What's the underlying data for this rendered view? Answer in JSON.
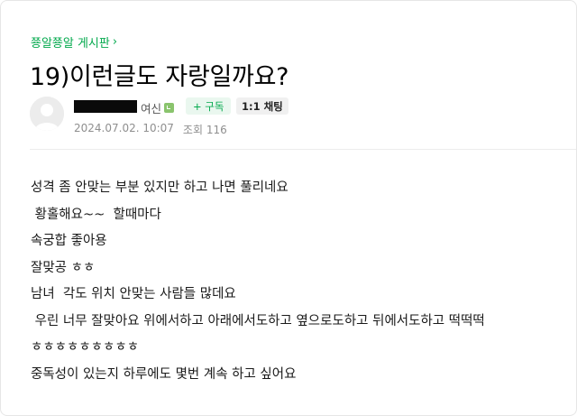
{
  "post": {
    "board_name": "쭁알쭁알 게시판",
    "board_chevron": "›",
    "title": "19)이런글도 자랑일까요?",
    "author": {
      "grade_label": "여신"
    },
    "subscribe_label": "+ 구독",
    "chat_label": "1:1 채팅",
    "date": "2024.07.02. 10:07",
    "views_label": "조회 116",
    "body_lines": [
      "성격 좀 안맞는 부분 있지만 하고 나면 풀리네요",
      " 황홀해요~~  할때마다",
      "속궁합 좋아용",
      "잘맞공 ㅎㅎ",
      "남녀  각도 위치 안맞는 사람들 많데요",
      " 우린 너무 잘맞아요 위에서하고 아래에서도하고 옆으로도하고 뒤에서도하고 떡떡떡",
      "ㅎㅎㅎㅎㅎㅎㅎㅎㅎ",
      "중독성이 있는지 하루에도 몇번 계속 하고 싶어요"
    ]
  },
  "icons": {
    "avatar": "default-profile-icon",
    "grade": "grade-badge-icon",
    "board_chevron": "chevron-right-icon"
  },
  "colors": {
    "accent_green": "#03a94d",
    "meta_gray": "#8f8f8f"
  }
}
